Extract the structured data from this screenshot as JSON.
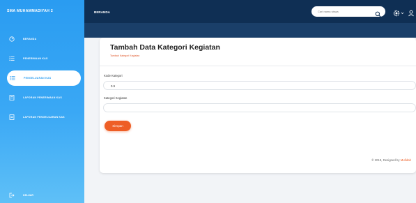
{
  "app": {
    "brand": "SMA MUHAMMADIYAH 2"
  },
  "sidebar": {
    "items": [
      {
        "label": "BERANDA",
        "icon": "dashboard-icon",
        "active": false
      },
      {
        "label": "PENERIMAAN KAS",
        "icon": "list-icon",
        "active": false
      },
      {
        "label": "PENGELUARAN KAS",
        "icon": "list-icon",
        "active": true
      },
      {
        "label": "LAPORAN PENERIMAAN KAS",
        "icon": "report-icon",
        "active": false
      },
      {
        "label": "LAPORAN PENGELUARAN KAS",
        "icon": "report-icon",
        "active": false
      }
    ],
    "logout": {
      "label": "KELUAR",
      "icon": "logout-icon"
    }
  },
  "topbar": {
    "page_label": "BERANDA",
    "search": {
      "placeholder": "Cari nama siswa",
      "value": ""
    },
    "icons": [
      "search-icon",
      "settings-icon",
      "user-icon"
    ]
  },
  "main": {
    "title": "Tambah Data Kategori Kegiatan",
    "subtitle": "Tambah Kategori Kegiatan",
    "form": {
      "kode_label": "Kode Kategori",
      "kode_value": "0.9",
      "kategori_label": "Kategori Kegiatan",
      "kategori_value": "",
      "submit_label": "Simpan"
    }
  },
  "footer": {
    "text": "© 2019, Designed by",
    "link": "Mufidah"
  },
  "colors": {
    "sidebar": "#2a9cf1",
    "topbar": "#0f2f54",
    "accent": "#ee5e25"
  }
}
